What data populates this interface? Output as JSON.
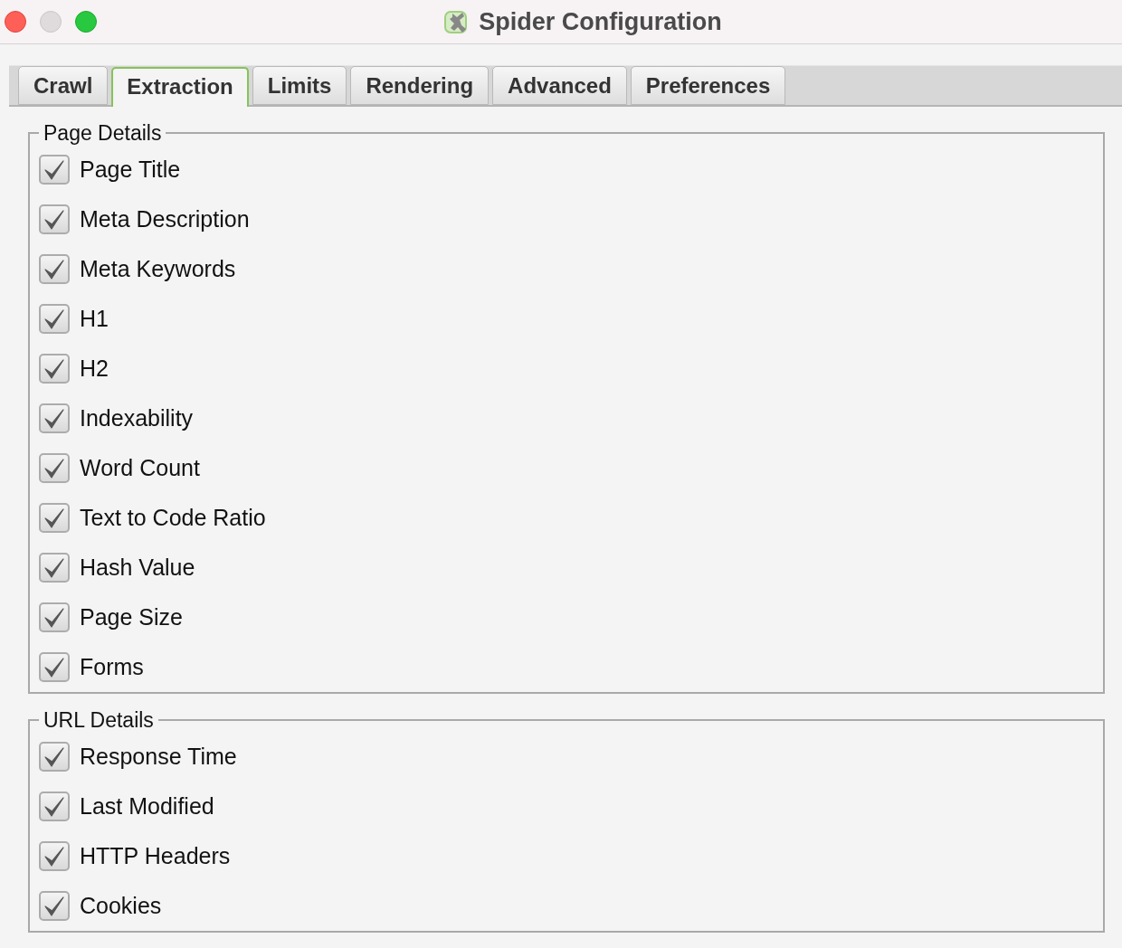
{
  "window": {
    "title": "Spider Configuration"
  },
  "tabs": [
    {
      "label": "Crawl",
      "selected": false
    },
    {
      "label": "Extraction",
      "selected": true
    },
    {
      "label": "Limits",
      "selected": false
    },
    {
      "label": "Rendering",
      "selected": false
    },
    {
      "label": "Advanced",
      "selected": false
    },
    {
      "label": "Preferences",
      "selected": false
    }
  ],
  "sections": [
    {
      "title": "Page Details",
      "options": [
        {
          "label": "Page Title",
          "checked": true
        },
        {
          "label": "Meta Description",
          "checked": true
        },
        {
          "label": "Meta Keywords",
          "checked": true
        },
        {
          "label": "H1",
          "checked": true
        },
        {
          "label": "H2",
          "checked": true
        },
        {
          "label": "Indexability",
          "checked": true
        },
        {
          "label": "Word Count",
          "checked": true
        },
        {
          "label": "Text to Code Ratio",
          "checked": true
        },
        {
          "label": "Hash Value",
          "checked": true
        },
        {
          "label": "Page Size",
          "checked": true
        },
        {
          "label": "Forms",
          "checked": true
        }
      ]
    },
    {
      "title": "URL Details",
      "options": [
        {
          "label": "Response Time",
          "checked": true
        },
        {
          "label": "Last Modified",
          "checked": true
        },
        {
          "label": "HTTP Headers",
          "checked": true
        },
        {
          "label": "Cookies",
          "checked": true
        }
      ]
    }
  ]
}
